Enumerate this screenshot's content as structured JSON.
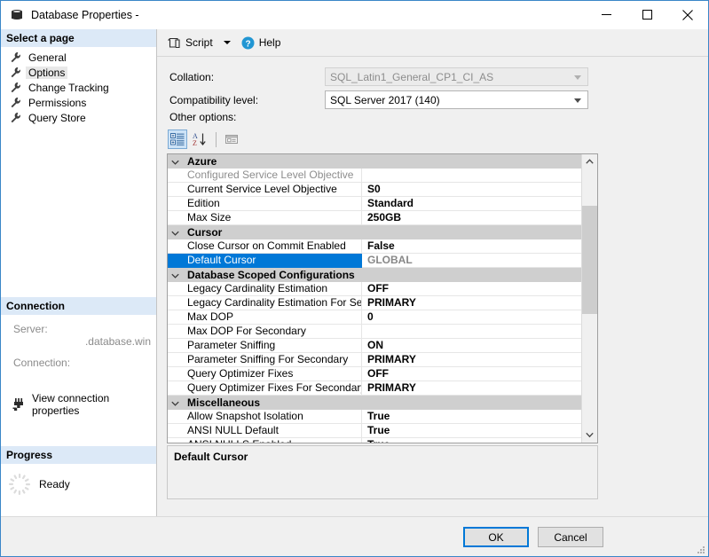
{
  "window": {
    "title": "Database Properties -",
    "icon": "database-icon",
    "controls": {
      "minimize": "minimize-icon",
      "maximize": "maximize-icon",
      "close": "close-icon"
    },
    "border_color": "#3a86c8"
  },
  "sidebar": {
    "header": "Select a page",
    "items": [
      {
        "label": "General",
        "icon": "wrench-icon",
        "selected": false
      },
      {
        "label": "Options",
        "icon": "wrench-icon",
        "selected": true
      },
      {
        "label": "Change Tracking",
        "icon": "wrench-icon",
        "selected": false
      },
      {
        "label": "Permissions",
        "icon": "wrench-icon",
        "selected": false
      },
      {
        "label": "Query Store",
        "icon": "wrench-icon",
        "selected": false
      }
    ],
    "connection": {
      "header": "Connection",
      "server_label": "Server:",
      "server_value": ".database.win",
      "connection_label": "Connection:",
      "connection_value": "",
      "link_label": "View connection properties",
      "link_icon": "plug-icon"
    },
    "progress": {
      "header": "Progress",
      "status": "Ready",
      "icon": "spinner-icon"
    }
  },
  "toolbar": {
    "script_label": "Script",
    "script_icon": "script-icon",
    "dropdown_icon": "chevron-down-icon",
    "help_label": "Help",
    "help_icon": "question-mark-icon"
  },
  "form": {
    "collation_label": "Collation:",
    "collation_value": "SQL_Latin1_General_CP1_CI_AS",
    "collation_disabled": true,
    "compatibility_label": "Compatibility level:",
    "compatibility_value": "SQL Server 2017 (140)",
    "other_options_label": "Other options:"
  },
  "grid_toolbar": {
    "categorized_icon": "categorized-view-icon",
    "alphabetical_icon": "alphabetical-sort-icon",
    "property_pages_icon": "property-pages-icon",
    "active": "categorized"
  },
  "property_grid": {
    "selected_row": "Default Cursor",
    "selection_color": "#0078d7",
    "category_color": "#cfcfcf",
    "rows": [
      {
        "type": "category",
        "name": "Azure"
      },
      {
        "type": "property",
        "name": "Configured Service Level Objective",
        "value": "",
        "dim": true
      },
      {
        "type": "property",
        "name": "Current Service Level Objective",
        "value": "S0"
      },
      {
        "type": "property",
        "name": "Edition",
        "value": "Standard"
      },
      {
        "type": "property",
        "name": "Max Size",
        "value": "250GB"
      },
      {
        "type": "category",
        "name": "Cursor"
      },
      {
        "type": "property",
        "name": "Close Cursor on Commit Enabled",
        "value": "False"
      },
      {
        "type": "property",
        "name": "Default Cursor",
        "value": "GLOBAL",
        "selected": true
      },
      {
        "type": "category",
        "name": "Database Scoped Configurations"
      },
      {
        "type": "property",
        "name": "Legacy Cardinality Estimation",
        "value": "OFF"
      },
      {
        "type": "property",
        "name": "Legacy Cardinality Estimation For Secondary",
        "value": "PRIMARY"
      },
      {
        "type": "property",
        "name": "Max DOP",
        "value": "0"
      },
      {
        "type": "property",
        "name": "Max DOP For Secondary",
        "value": ""
      },
      {
        "type": "property",
        "name": "Parameter Sniffing",
        "value": "ON"
      },
      {
        "type": "property",
        "name": "Parameter Sniffing For Secondary",
        "value": "PRIMARY"
      },
      {
        "type": "property",
        "name": "Query Optimizer Fixes",
        "value": "OFF"
      },
      {
        "type": "property",
        "name": "Query Optimizer Fixes For Secondary",
        "value": "PRIMARY"
      },
      {
        "type": "category",
        "name": "Miscellaneous"
      },
      {
        "type": "property",
        "name": "Allow Snapshot Isolation",
        "value": "True"
      },
      {
        "type": "property",
        "name": "ANSI NULL Default",
        "value": "True"
      },
      {
        "type": "property",
        "name": "ANSI NULLS Enabled",
        "value": "True"
      }
    ]
  },
  "description": {
    "title": "Default Cursor",
    "text": ""
  },
  "footer": {
    "ok_label": "OK",
    "cancel_label": "Cancel"
  }
}
